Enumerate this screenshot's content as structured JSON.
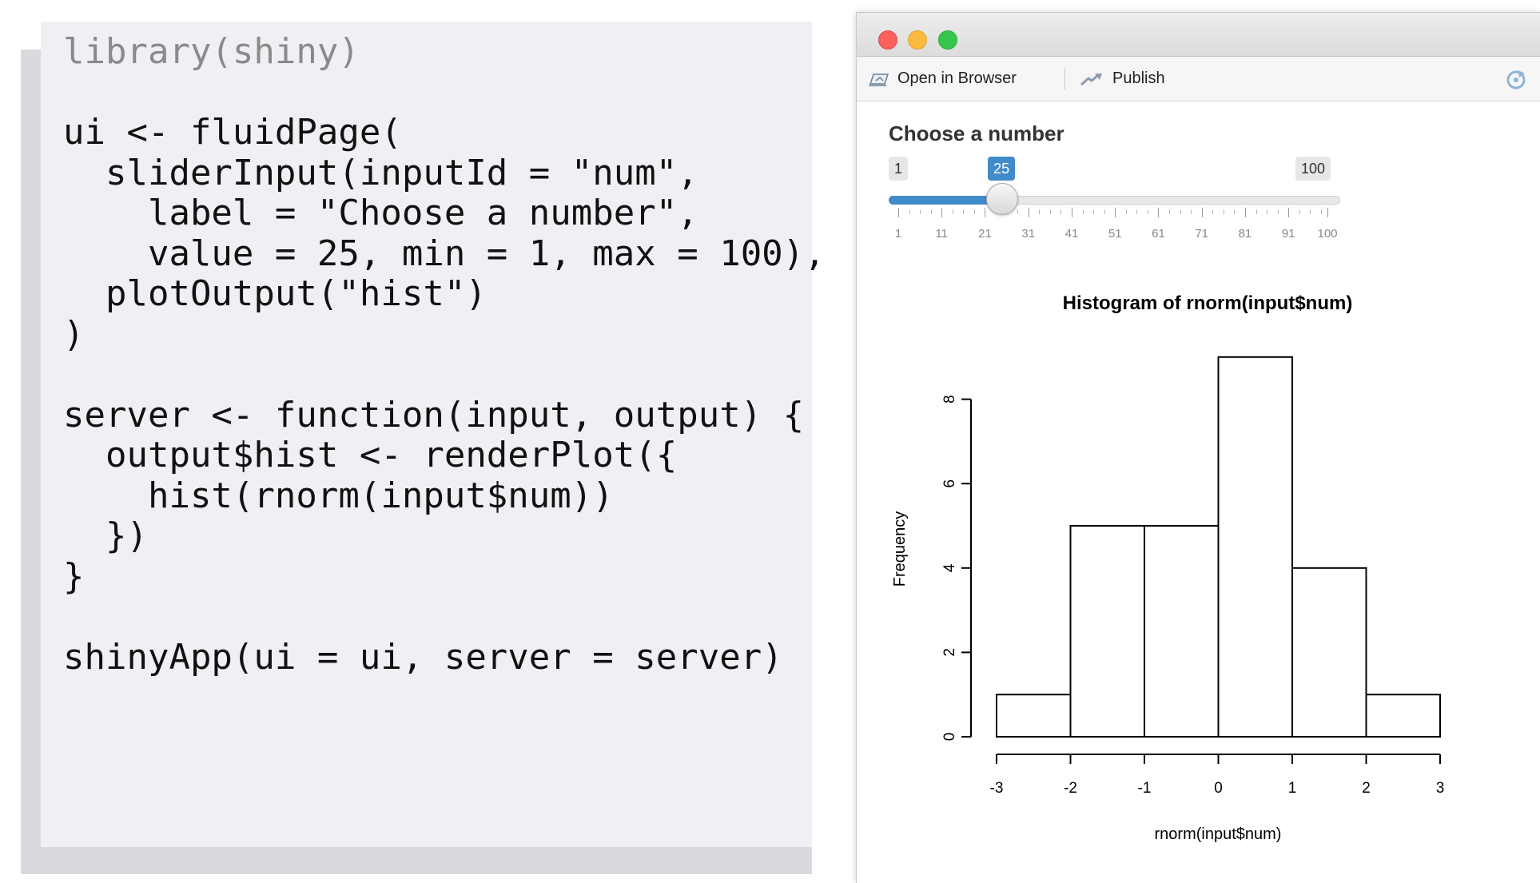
{
  "code": {
    "lines": [
      "library(shiny)",
      "",
      "ui <- fluidPage(",
      "  sliderInput(inputId = \"num\",",
      "    label = \"Choose a number\",",
      "    value = 25, min = 1, max = 100),",
      "  plotOutput(\"hist\")",
      ")",
      "",
      "server <- function(input, output) {",
      "  output$hist <- renderPlot({",
      "    hist(rnorm(input$num))",
      "  })",
      "}",
      "",
      "shinyApp(ui = ui, server = server)"
    ]
  },
  "window": {
    "toolbar": {
      "open_in_browser": "Open in Browser",
      "publish": "Publish"
    },
    "slider": {
      "label": "Choose a number",
      "min": 1,
      "max": 100,
      "value": 25,
      "min_label": "1",
      "max_label": "100",
      "value_label": "25",
      "tick_labels": [
        "1",
        "11",
        "21",
        "31",
        "41",
        "51",
        "61",
        "71",
        "81",
        "91",
        "100"
      ],
      "accent": "#428bca"
    }
  },
  "chart_data": {
    "type": "bar",
    "title": "Histogram of rnorm(input$num)",
    "xlabel": "rnorm(input$num)",
    "ylabel": "Frequency",
    "bins": [
      [
        -3,
        -2
      ],
      [
        -2,
        -1
      ],
      [
        -1,
        0
      ],
      [
        0,
        1
      ],
      [
        1,
        2
      ],
      [
        2,
        3
      ]
    ],
    "values": [
      1,
      5,
      5,
      9,
      4,
      1
    ],
    "x_ticks": [
      "-3",
      "-2",
      "-1",
      "0",
      "1",
      "2",
      "3"
    ],
    "y_ticks": [
      "0",
      "2",
      "4",
      "6",
      "8"
    ],
    "xlim": [
      -3,
      3
    ],
    "ylim": [
      0,
      9
    ],
    "grid": false
  }
}
